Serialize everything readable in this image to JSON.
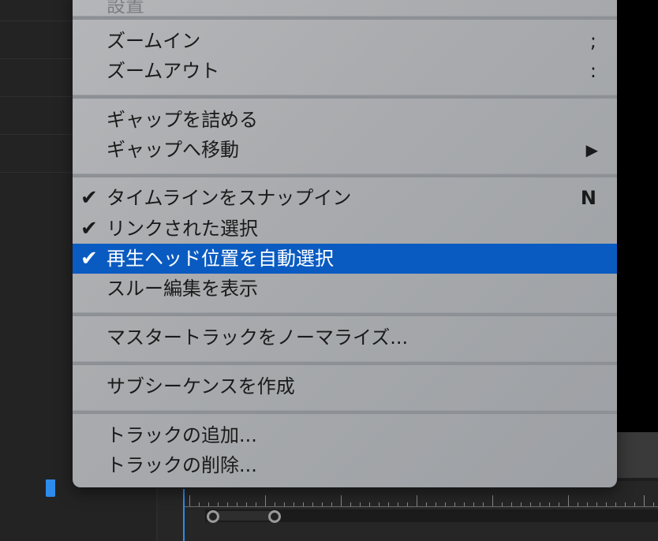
{
  "menu": {
    "items": [
      {
        "id": "prev",
        "label": "設置",
        "disabled": true
      },
      {
        "id": "zoom-in",
        "label": "ズームイン",
        "shortcut": ";"
      },
      {
        "id": "zoom-out",
        "label": "ズームアウト",
        "shortcut": ":"
      },
      {
        "id": "close-gap",
        "label": "ギャップを詰める"
      },
      {
        "id": "go-to-gap",
        "label": "ギャップへ移動",
        "submenu_arrow": "▶"
      },
      {
        "id": "snap",
        "label": "タイムラインをスナップイン",
        "shortcut": "N",
        "checked": true,
        "check": "✔"
      },
      {
        "id": "linked-selection",
        "label": "リンクされた選択",
        "checked": true,
        "check": "✔"
      },
      {
        "id": "select-at-playhead",
        "label": "再生ヘッド位置を自動選択",
        "checked": true,
        "check": "✔",
        "highlighted": true
      },
      {
        "id": "show-through-edits",
        "label": "スルー編集を表示"
      },
      {
        "id": "normalize-master",
        "label": "マスタートラックをノーマライズ..."
      },
      {
        "id": "make-subsequence",
        "label": "サブシーケンスを作成"
      },
      {
        "id": "add-tracks",
        "label": "トラックの追加..."
      },
      {
        "id": "delete-tracks",
        "label": "トラックの削除..."
      }
    ]
  },
  "colors": {
    "highlight": "#0a5bc1",
    "playhead": "#2d8ceb"
  }
}
